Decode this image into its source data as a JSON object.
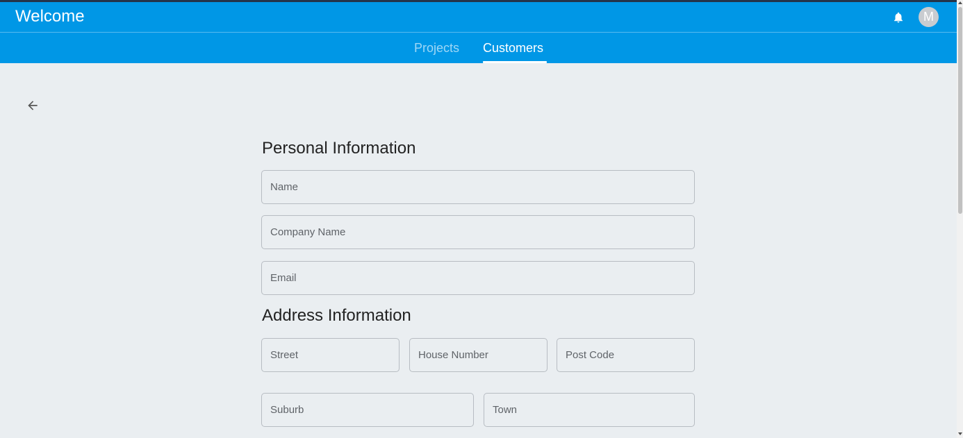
{
  "header": {
    "title": "Welcome",
    "notification_icon": "bell-icon",
    "avatar_initial": "M",
    "accent_color": "#0097e6"
  },
  "tabs": [
    {
      "label": "Projects",
      "active": false
    },
    {
      "label": "Customers",
      "active": true
    }
  ],
  "back_icon": "arrow-left-icon",
  "personal_section": {
    "heading": "Personal Information",
    "fields": {
      "name": {
        "placeholder": "Name",
        "value": ""
      },
      "company": {
        "placeholder": "Company Name",
        "value": ""
      },
      "email": {
        "placeholder": "Email",
        "value": ""
      }
    }
  },
  "address_section": {
    "heading": "Address Information",
    "fields": {
      "street": {
        "placeholder": "Street",
        "value": ""
      },
      "house_number": {
        "placeholder": "House Number",
        "value": ""
      },
      "post_code": {
        "placeholder": "Post Code",
        "value": ""
      },
      "suburb": {
        "placeholder": "Suburb",
        "value": ""
      },
      "town": {
        "placeholder": "Town",
        "value": ""
      }
    }
  }
}
